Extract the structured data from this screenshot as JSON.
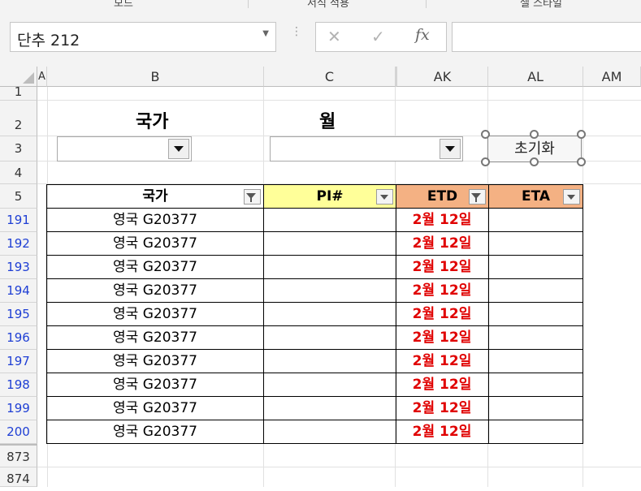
{
  "ribbon": {
    "groups": [
      "모드",
      "서식 적용",
      "셀 스타일"
    ]
  },
  "formula_bar": {
    "name_box": "단추 212",
    "cancel_icon": "close-icon",
    "enter_icon": "check-icon",
    "fx_label": "fx",
    "formula": ""
  },
  "columns": [
    "A",
    "B",
    "C",
    "AK",
    "AL",
    "AM"
  ],
  "rows": [
    "1",
    "2",
    "3",
    "4",
    "5",
    "191",
    "192",
    "193",
    "194",
    "195",
    "196",
    "197",
    "198",
    "199",
    "200",
    "873",
    "874"
  ],
  "filter_area": {
    "country_label": "국가",
    "month_label": "월",
    "country_value": "",
    "month_value": "",
    "reset_button": "초기화"
  },
  "table": {
    "headers": [
      "국가",
      "PI#",
      "ETD",
      "ETA"
    ],
    "header_colors": [
      "#ffffff",
      "#ffff99",
      "#f4b183",
      "#f4b183"
    ],
    "rows": [
      [
        "영국 G20377",
        "",
        "2월 12일",
        ""
      ],
      [
        "영국 G20377",
        "",
        "2월 12일",
        ""
      ],
      [
        "영국 G20377",
        "",
        "2월 12일",
        ""
      ],
      [
        "영국 G20377",
        "",
        "2월 12일",
        ""
      ],
      [
        "영국 G20377",
        "",
        "2월 12일",
        ""
      ],
      [
        "영국 G20377",
        "",
        "2월 12일",
        ""
      ],
      [
        "영국 G20377",
        "",
        "2월 12일",
        ""
      ],
      [
        "영국 G20377",
        "",
        "2월 12일",
        ""
      ],
      [
        "영국 G20377",
        "",
        "2월 12일",
        ""
      ],
      [
        "영국 G20377",
        "",
        "2월 12일",
        ""
      ]
    ]
  }
}
